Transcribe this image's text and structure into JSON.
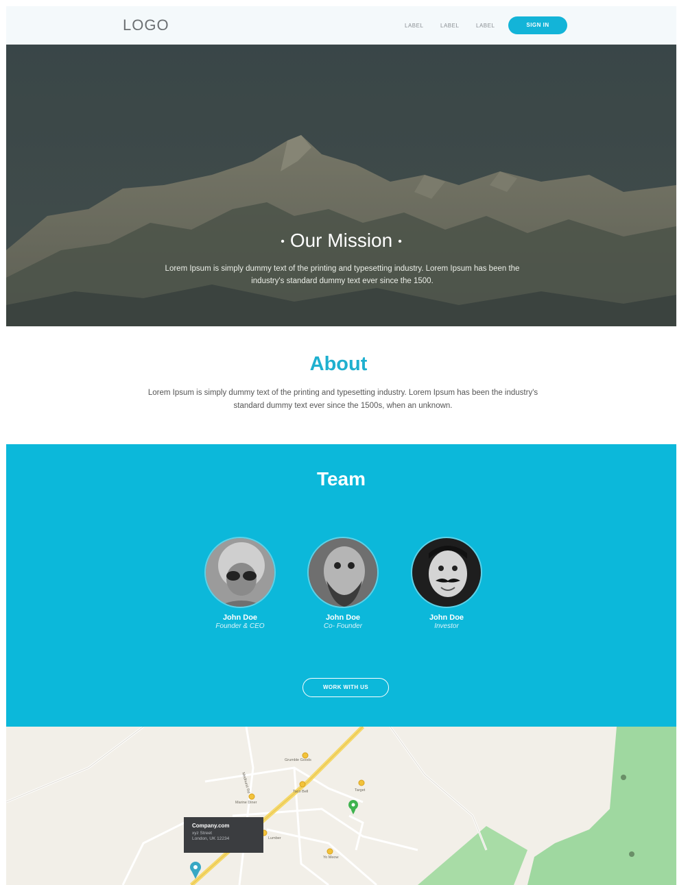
{
  "header": {
    "logo": "LOGO",
    "nav": [
      "LABEL",
      "LABEL",
      "LABEL"
    ],
    "signin": "SIGN IN"
  },
  "hero": {
    "dot": "•",
    "title": "Our Mission",
    "text": "Lorem Ipsum is simply dummy text of the printing and typesetting industry. Lorem Ipsum has been the industry's standard dummy text ever since the 1500."
  },
  "about": {
    "title": "About",
    "text": "Lorem Ipsum is simply dummy text of the printing and typesetting industry. Lorem Ipsum has been the industry's standard dummy text ever since the 1500s, when an unknown."
  },
  "team": {
    "title": "Team",
    "members": [
      {
        "name": "John Doe",
        "role": "Founder & CEO"
      },
      {
        "name": "John Doe",
        "role": "Co- Founder"
      },
      {
        "name": "John Doe",
        "role": "Investor"
      }
    ],
    "cta": "WORK WITH US"
  },
  "map": {
    "company": {
      "name": "Company.com",
      "street": "xyz Street",
      "city": "London, UK 12234"
    },
    "places": [
      "Grumble Goods",
      "Taco Bell",
      "Target",
      "Marine Diner",
      "Lumber",
      "Yo Meow"
    ],
    "streets": [
      "Medhurst Rd"
    ],
    "colors": {
      "land": "#f2efe8",
      "park": "#9fd8a0",
      "road": "#f5d86a"
    }
  },
  "colors": {
    "accent": "#13b4d8",
    "team_bg": "#0cb8da",
    "about_title": "#1fb0cf",
    "header_bg": "#f4f9fb"
  }
}
